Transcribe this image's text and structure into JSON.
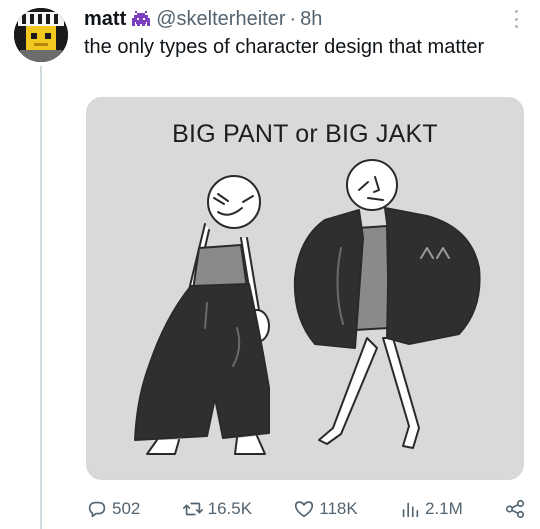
{
  "tweet": {
    "author_name": "matt",
    "handle": "@skelterheiter",
    "separator": "·",
    "time": "8h",
    "text": "the only types of character design that matter"
  },
  "media": {
    "caption": "BIG PANT or BIG JAKT"
  },
  "actions": {
    "replies": "502",
    "reposts": "16.5K",
    "likes": "118K",
    "views": "2.1M"
  },
  "icons": {
    "badge": "purple-alien-emoji-icon",
    "more": "more-options-icon",
    "reply": "reply-icon",
    "repost": "repost-icon",
    "like": "heart-icon",
    "views": "views-chart-icon",
    "share": "share-icon"
  },
  "colors": {
    "text": "#0f1419",
    "secondary": "#536471",
    "badge_purple": "#7b3fbf",
    "media_bg": "#d9d9d9",
    "pants": "#2f2f2f",
    "shirt": "#8a8a8a"
  }
}
